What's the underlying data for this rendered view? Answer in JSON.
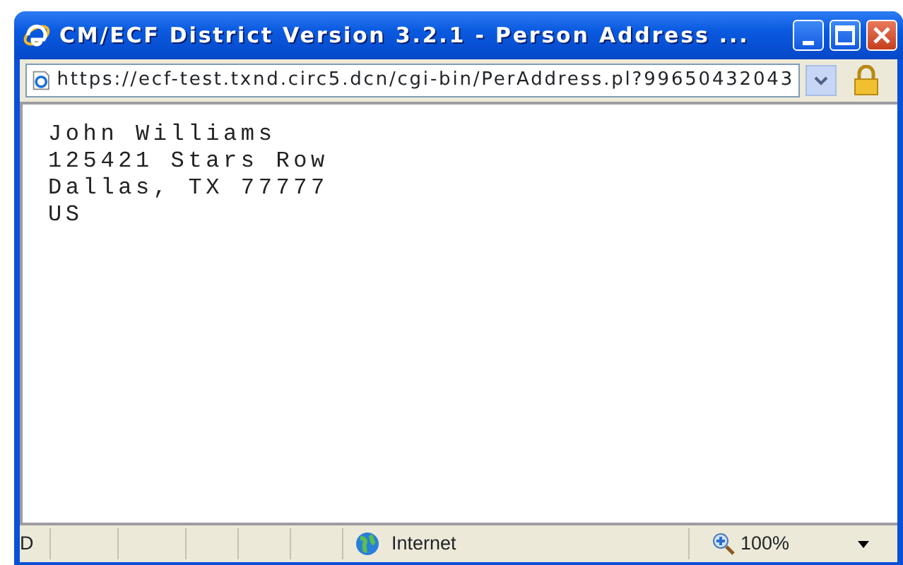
{
  "window": {
    "title": "CM/ECF District Version 3.2.1 - Person Address ..."
  },
  "address_bar": {
    "url": "https://ecf-test.txnd.circ5.dcn/cgi-bin/PerAddress.pl?99650432043"
  },
  "content": {
    "lines": [
      "John Williams",
      "125421 Stars Row",
      "Dallas, TX 77777",
      "US"
    ]
  },
  "status_bar": {
    "status_text": "D",
    "zone": "Internet",
    "zoom": "100%"
  }
}
